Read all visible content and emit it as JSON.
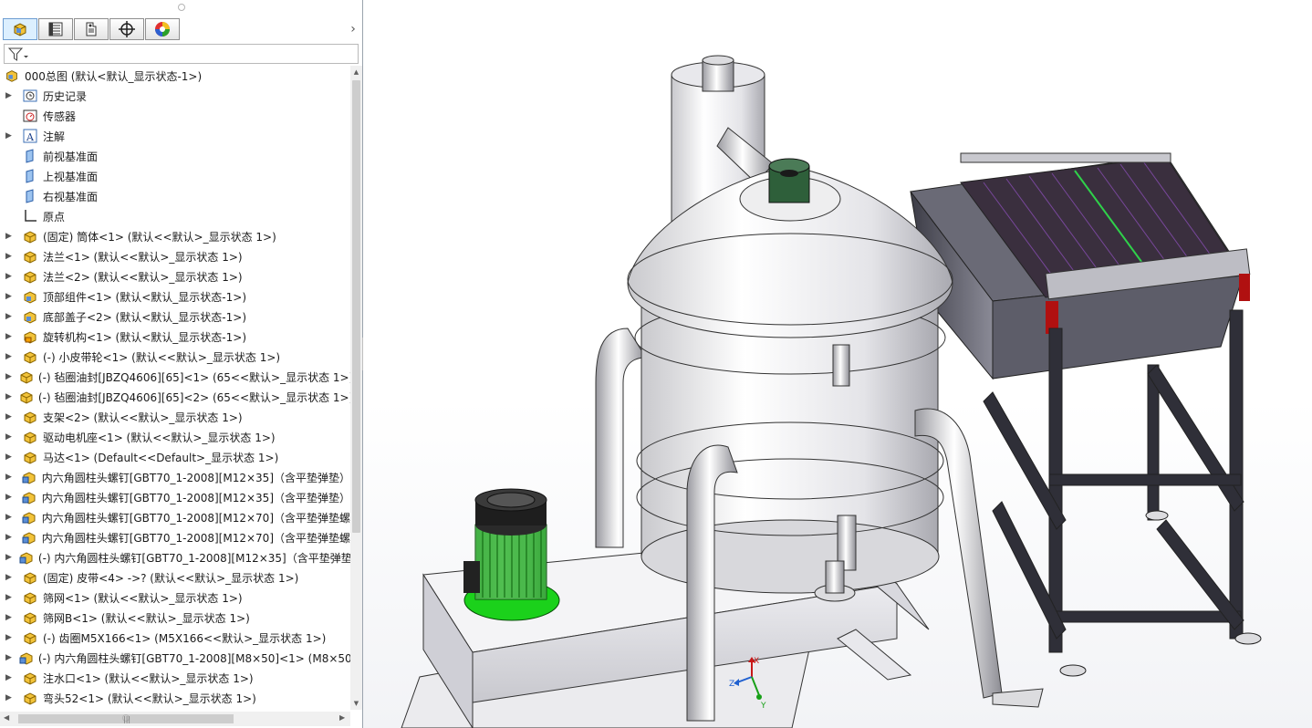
{
  "tabs": [
    {
      "name": "featuremanager-tab",
      "icon": "assembly-icon"
    },
    {
      "name": "propertymanager-tab",
      "icon": "property-list-icon"
    },
    {
      "name": "configurationmanager-tab",
      "icon": "configuration-icon"
    },
    {
      "name": "dimxpert-tab",
      "icon": "crosshair-icon"
    },
    {
      "name": "display-manager-tab",
      "icon": "color-wheel-icon"
    }
  ],
  "tree": {
    "root": "000总图  (默认<默认_显示状态-1>)",
    "items": [
      {
        "label": "历史记录",
        "icon": "history-icon",
        "expand": true
      },
      {
        "label": "传感器",
        "icon": "sensor-icon",
        "expand": false
      },
      {
        "label": "注解",
        "icon": "annotation-icon",
        "expand": true
      },
      {
        "label": "前视基准面",
        "icon": "plane-icon",
        "expand": false
      },
      {
        "label": "上视基准面",
        "icon": "plane-icon",
        "expand": false
      },
      {
        "label": "右视基准面",
        "icon": "plane-icon",
        "expand": false
      },
      {
        "label": "原点",
        "icon": "origin-icon",
        "expand": false
      },
      {
        "label": "(固定) 筒体<1> (默认<<默认>_显示状态 1>)",
        "icon": "part-icon",
        "expand": true
      },
      {
        "label": "法兰<1> (默认<<默认>_显示状态 1>)",
        "icon": "part-icon",
        "expand": true
      },
      {
        "label": "法兰<2> (默认<<默认>_显示状态 1>)",
        "icon": "part-icon",
        "expand": true
      },
      {
        "label": "顶部组件<1> (默认<默认_显示状态-1>)",
        "icon": "assembly-icon",
        "expand": true
      },
      {
        "label": "底部盖子<2> (默认<默认_显示状态-1>)",
        "icon": "assembly-icon",
        "expand": true
      },
      {
        "label": "旋转机构<1> (默认<默认_显示状态-1>)",
        "icon": "assembly-warning-icon",
        "expand": true
      },
      {
        "label": "(-) 小皮带轮<1> (默认<<默认>_显示状态 1>)",
        "icon": "part-icon",
        "expand": true
      },
      {
        "label": "(-) 毡圈油封[JBZQ4606][65]<1> (65<<默认>_显示状态 1>)",
        "icon": "part-icon",
        "expand": true
      },
      {
        "label": "(-) 毡圈油封[JBZQ4606][65]<2> (65<<默认>_显示状态 1>)",
        "icon": "part-icon",
        "expand": true
      },
      {
        "label": "支架<2> (默认<<默认>_显示状态 1>)",
        "icon": "part-icon",
        "expand": true
      },
      {
        "label": "驱动电机座<1> (默认<<默认>_显示状态 1>)",
        "icon": "part-icon",
        "expand": true
      },
      {
        "label": "马达<1> (Default<<Default>_显示状态 1>)",
        "icon": "part-icon",
        "expand": true
      },
      {
        "label": "内六角圆柱头螺钉[GBT70_1-2008][M12×35]（含平垫弹垫）",
        "icon": "toolbox-part-icon",
        "expand": true
      },
      {
        "label": "内六角圆柱头螺钉[GBT70_1-2008][M12×35]（含平垫弹垫）",
        "icon": "toolbox-part-icon",
        "expand": true
      },
      {
        "label": "内六角圆柱头螺钉[GBT70_1-2008][M12×70]（含平垫弹垫螺",
        "icon": "toolbox-part-icon",
        "expand": true
      },
      {
        "label": "内六角圆柱头螺钉[GBT70_1-2008][M12×70]（含平垫弹垫螺",
        "icon": "toolbox-part-icon",
        "expand": true
      },
      {
        "label": "(-) 内六角圆柱头螺钉[GBT70_1-2008][M12×35]（含平垫弹垫",
        "icon": "toolbox-part-icon",
        "expand": true
      },
      {
        "label": "(固定) 皮带<4> ->? (默认<<默认>_显示状态 1>)",
        "icon": "part-icon",
        "expand": true
      },
      {
        "label": "筛网<1> (默认<<默认>_显示状态 1>)",
        "icon": "part-icon",
        "expand": true
      },
      {
        "label": "筛网B<1> (默认<<默认>_显示状态 1>)",
        "icon": "part-icon",
        "expand": true
      },
      {
        "label": "(-) 齿圈M5X166<1> (M5X166<<默认>_显示状态 1>)",
        "icon": "part-icon",
        "expand": true
      },
      {
        "label": "(-) 内六角圆柱头螺钉[GBT70_1-2008][M8×50]<1> (M8×50",
        "icon": "toolbox-part-icon",
        "expand": true
      },
      {
        "label": "注水口<1> (默认<<默认>_显示状态 1>)",
        "icon": "part-icon",
        "expand": true
      },
      {
        "label": "弯头52<1> (默认<<默认>_显示状态 1>)",
        "icon": "part-icon",
        "expand": true
      }
    ]
  },
  "triad": {
    "x": "X",
    "y": "Y",
    "z": "Z"
  },
  "colors": {
    "accent": "#6d9cd1",
    "part_yellow": "#e8b923",
    "motor_green": "#16c216"
  }
}
